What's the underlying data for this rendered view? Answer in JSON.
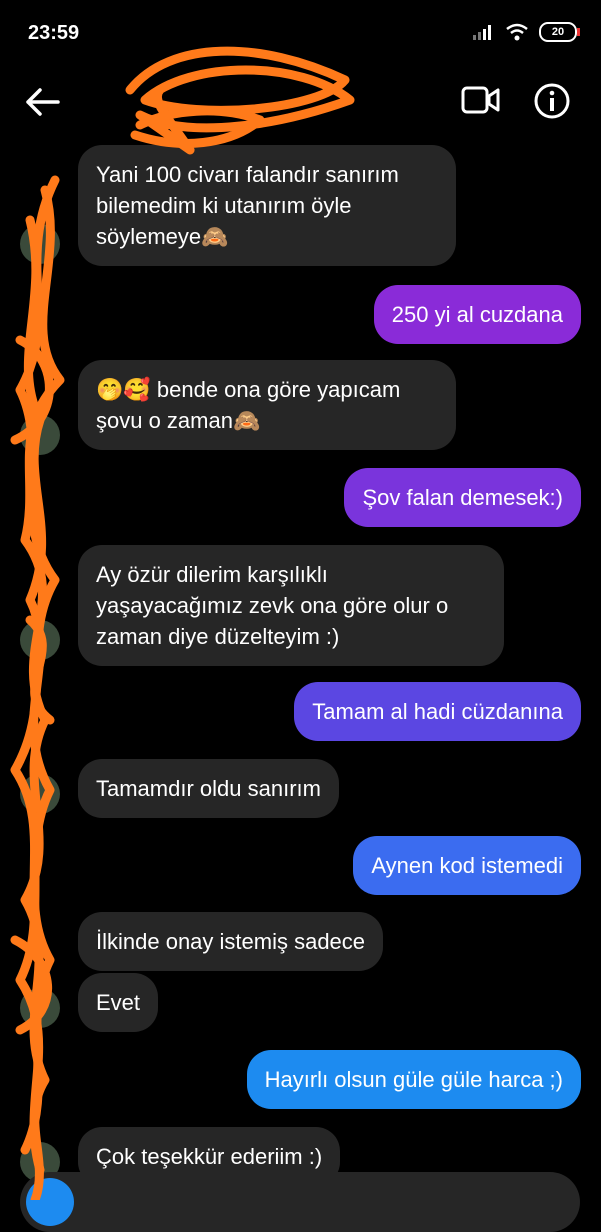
{
  "status": {
    "time": "23:59",
    "battery": "20",
    "icons": [
      "signal-icon",
      "wifi-icon",
      "battery-icon"
    ]
  },
  "header": {
    "icons": [
      "back-arrow-icon",
      "video-call-icon",
      "info-icon"
    ]
  },
  "messages": [
    {
      "dir": "in",
      "text": "Yani 100 civarı falandır sanırım\nbilemedim ki utanırım öyle\nsöylemeye🙈"
    },
    {
      "dir": "out",
      "text": "250 yi al cuzdana"
    },
    {
      "dir": "in",
      "text": "🤭🥰 bende ona göre yapıcam\nşovu o zaman🙈"
    },
    {
      "dir": "out",
      "text": "Şov falan demesek:)"
    },
    {
      "dir": "in",
      "text": "Ay özür dilerim karşılıklı\nyaşayacağımız zevk ona göre olur o\nzaman diye düzelteyim :)"
    },
    {
      "dir": "out",
      "text": "Tamam al hadi cüzdanına"
    },
    {
      "dir": "in",
      "text": "Tamamdır oldu sanırım"
    },
    {
      "dir": "out",
      "text": "Aynen kod istemedi"
    },
    {
      "dir": "in",
      "text": "İlkinde onay istemiş sadece"
    },
    {
      "dir": "in",
      "text": "Evet"
    },
    {
      "dir": "out",
      "text": "Hayırlı olsun güle güle harca ;)"
    },
    {
      "dir": "in",
      "text": "Çok teşekkür ederiim :)"
    }
  ],
  "colors": {
    "incoming_bubble": "#262626",
    "outgoing_gradient": [
      "#8a2bd8",
      "#6a3de0",
      "#3b6cf0",
      "#1d8bf0"
    ],
    "redaction": "#ff7a1a",
    "background": "#000000"
  },
  "composer": {
    "icons": [
      "camera-icon",
      "mic-icon",
      "gallery-icon",
      "sticker-icon"
    ]
  }
}
